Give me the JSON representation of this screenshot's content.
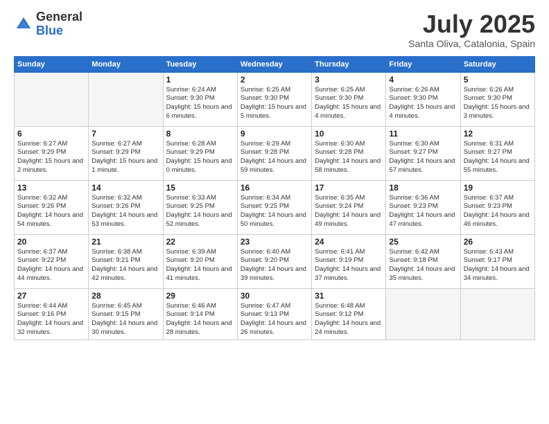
{
  "header": {
    "logo_general": "General",
    "logo_blue": "Blue",
    "title": "July 2025",
    "subtitle": "Santa Oliva, Catalonia, Spain"
  },
  "weekdays": [
    "Sunday",
    "Monday",
    "Tuesday",
    "Wednesday",
    "Thursday",
    "Friday",
    "Saturday"
  ],
  "weeks": [
    [
      {
        "day": "",
        "info": ""
      },
      {
        "day": "",
        "info": ""
      },
      {
        "day": "1",
        "info": "Sunrise: 6:24 AM\nSunset: 9:30 PM\nDaylight: 15 hours and 6 minutes."
      },
      {
        "day": "2",
        "info": "Sunrise: 6:25 AM\nSunset: 9:30 PM\nDaylight: 15 hours and 5 minutes."
      },
      {
        "day": "3",
        "info": "Sunrise: 6:25 AM\nSunset: 9:30 PM\nDaylight: 15 hours and 4 minutes."
      },
      {
        "day": "4",
        "info": "Sunrise: 6:26 AM\nSunset: 9:30 PM\nDaylight: 15 hours and 4 minutes."
      },
      {
        "day": "5",
        "info": "Sunrise: 6:26 AM\nSunset: 9:30 PM\nDaylight: 15 hours and 3 minutes."
      }
    ],
    [
      {
        "day": "6",
        "info": "Sunrise: 6:27 AM\nSunset: 9:29 PM\nDaylight: 15 hours and 2 minutes."
      },
      {
        "day": "7",
        "info": "Sunrise: 6:27 AM\nSunset: 9:29 PM\nDaylight: 15 hours and 1 minute."
      },
      {
        "day": "8",
        "info": "Sunrise: 6:28 AM\nSunset: 9:29 PM\nDaylight: 15 hours and 0 minutes."
      },
      {
        "day": "9",
        "info": "Sunrise: 6:29 AM\nSunset: 9:28 PM\nDaylight: 14 hours and 59 minutes."
      },
      {
        "day": "10",
        "info": "Sunrise: 6:30 AM\nSunset: 9:28 PM\nDaylight: 14 hours and 58 minutes."
      },
      {
        "day": "11",
        "info": "Sunrise: 6:30 AM\nSunset: 9:27 PM\nDaylight: 14 hours and 57 minutes."
      },
      {
        "day": "12",
        "info": "Sunrise: 6:31 AM\nSunset: 9:27 PM\nDaylight: 14 hours and 55 minutes."
      }
    ],
    [
      {
        "day": "13",
        "info": "Sunrise: 6:32 AM\nSunset: 9:26 PM\nDaylight: 14 hours and 54 minutes."
      },
      {
        "day": "14",
        "info": "Sunrise: 6:32 AM\nSunset: 9:26 PM\nDaylight: 14 hours and 53 minutes."
      },
      {
        "day": "15",
        "info": "Sunrise: 6:33 AM\nSunset: 9:25 PM\nDaylight: 14 hours and 52 minutes."
      },
      {
        "day": "16",
        "info": "Sunrise: 6:34 AM\nSunset: 9:25 PM\nDaylight: 14 hours and 50 minutes."
      },
      {
        "day": "17",
        "info": "Sunrise: 6:35 AM\nSunset: 9:24 PM\nDaylight: 14 hours and 49 minutes."
      },
      {
        "day": "18",
        "info": "Sunrise: 6:36 AM\nSunset: 9:23 PM\nDaylight: 14 hours and 47 minutes."
      },
      {
        "day": "19",
        "info": "Sunrise: 6:37 AM\nSunset: 9:23 PM\nDaylight: 14 hours and 46 minutes."
      }
    ],
    [
      {
        "day": "20",
        "info": "Sunrise: 6:37 AM\nSunset: 9:22 PM\nDaylight: 14 hours and 44 minutes."
      },
      {
        "day": "21",
        "info": "Sunrise: 6:38 AM\nSunset: 9:21 PM\nDaylight: 14 hours and 42 minutes."
      },
      {
        "day": "22",
        "info": "Sunrise: 6:39 AM\nSunset: 9:20 PM\nDaylight: 14 hours and 41 minutes."
      },
      {
        "day": "23",
        "info": "Sunrise: 6:40 AM\nSunset: 9:20 PM\nDaylight: 14 hours and 39 minutes."
      },
      {
        "day": "24",
        "info": "Sunrise: 6:41 AM\nSunset: 9:19 PM\nDaylight: 14 hours and 37 minutes."
      },
      {
        "day": "25",
        "info": "Sunrise: 6:42 AM\nSunset: 9:18 PM\nDaylight: 14 hours and 35 minutes."
      },
      {
        "day": "26",
        "info": "Sunrise: 6:43 AM\nSunset: 9:17 PM\nDaylight: 14 hours and 34 minutes."
      }
    ],
    [
      {
        "day": "27",
        "info": "Sunrise: 6:44 AM\nSunset: 9:16 PM\nDaylight: 14 hours and 32 minutes."
      },
      {
        "day": "28",
        "info": "Sunrise: 6:45 AM\nSunset: 9:15 PM\nDaylight: 14 hours and 30 minutes."
      },
      {
        "day": "29",
        "info": "Sunrise: 6:46 AM\nSunset: 9:14 PM\nDaylight: 14 hours and 28 minutes."
      },
      {
        "day": "30",
        "info": "Sunrise: 6:47 AM\nSunset: 9:13 PM\nDaylight: 14 hours and 26 minutes."
      },
      {
        "day": "31",
        "info": "Sunrise: 6:48 AM\nSunset: 9:12 PM\nDaylight: 14 hours and 24 minutes."
      },
      {
        "day": "",
        "info": ""
      },
      {
        "day": "",
        "info": ""
      }
    ]
  ]
}
